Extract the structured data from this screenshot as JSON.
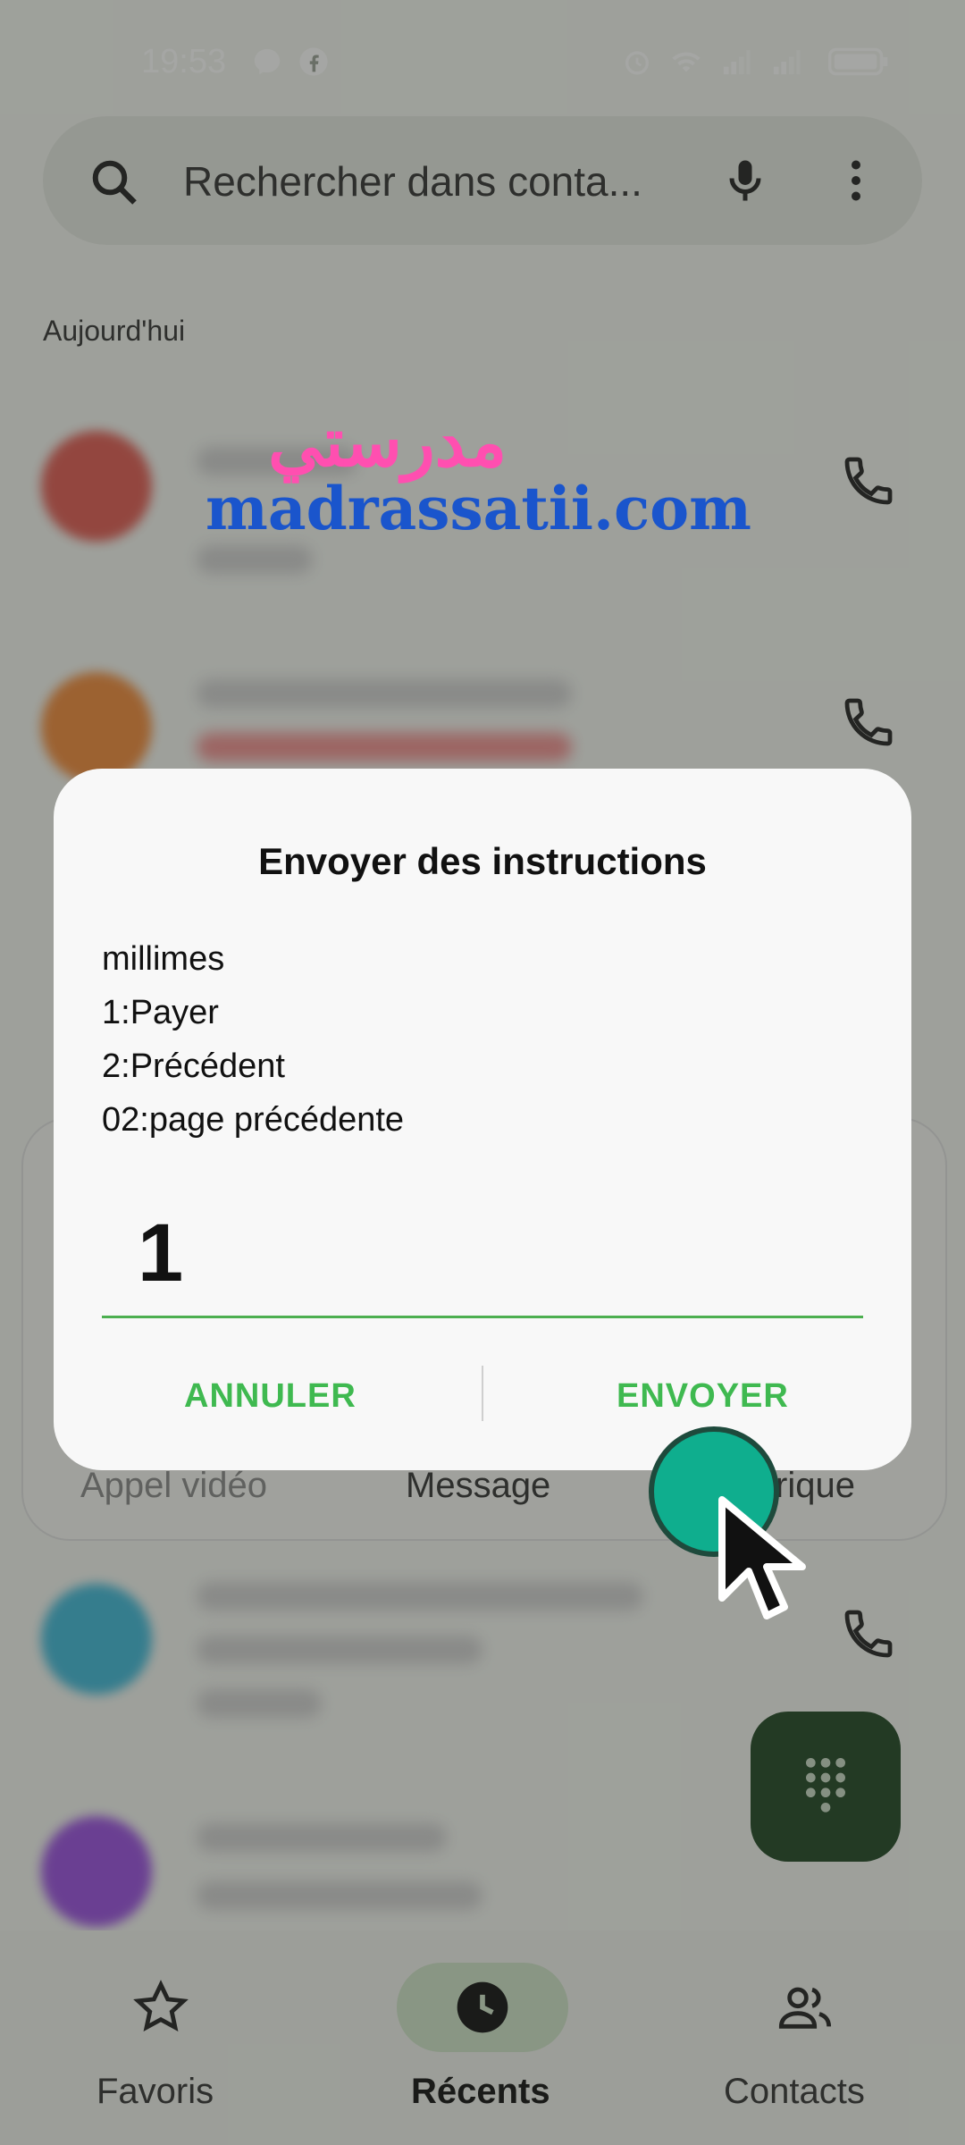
{
  "status_bar": {
    "time": "19:53"
  },
  "search": {
    "placeholder": "Rechercher dans conta..."
  },
  "section": {
    "today_label": "Aujourd'hui"
  },
  "actions": {
    "video": "Appel vidéo",
    "message": "Message",
    "history_fragment": "rique"
  },
  "dialog": {
    "title": "Envoyer des instructions",
    "lines": [
      "millimes",
      "1:Payer",
      "2:Précédent",
      "02:page précédente"
    ],
    "input_value": "1",
    "cancel_label": "ANNULER",
    "send_label": "ENVOYER"
  },
  "nav": {
    "items": [
      {
        "label": "Favoris",
        "icon": "star-icon"
      },
      {
        "label": "Récents",
        "icon": "clock-icon"
      },
      {
        "label": "Contacts",
        "icon": "people-icon"
      }
    ]
  },
  "watermark": {
    "arabic": "مدرستي",
    "latin": "madrassatii.com"
  },
  "colors": {
    "accent": "#3fb950",
    "fab": "#1f4524",
    "cursor_dot": "#0fae8e"
  }
}
